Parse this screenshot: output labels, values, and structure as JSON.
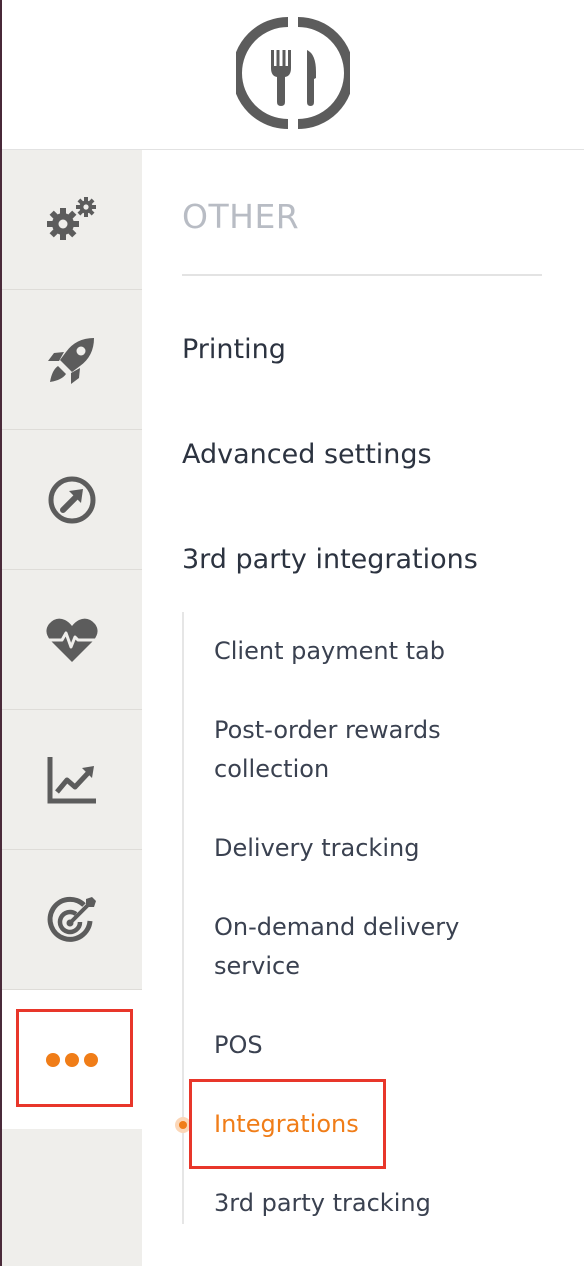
{
  "header": {
    "logo": "fork-knife-logo-icon"
  },
  "rail": {
    "items": [
      {
        "icon": "gears-icon"
      },
      {
        "icon": "rocket-icon"
      },
      {
        "icon": "arrow-circle-icon"
      },
      {
        "icon": "heart-pulse-icon"
      },
      {
        "icon": "line-chart-icon"
      },
      {
        "icon": "target-icon"
      },
      {
        "icon": "more-dots-icon",
        "active": true
      }
    ]
  },
  "panel": {
    "section_title": "OTHER",
    "items": [
      {
        "label": "Printing"
      },
      {
        "label": "Advanced settings"
      },
      {
        "label": "3rd party integrations"
      }
    ],
    "sub_items": [
      {
        "label": "Client payment tab"
      },
      {
        "label": "Post-order rewards collection"
      },
      {
        "label": "Delivery tracking"
      },
      {
        "label": "On-demand delivery service"
      },
      {
        "label": "POS"
      },
      {
        "label": "Integrations",
        "active": true
      },
      {
        "label": "3rd party tracking"
      }
    ]
  },
  "colors": {
    "accent": "#f07d18",
    "highlight": "#e8362a",
    "icon": "#5c5c5c",
    "rail_bg": "#efeeeb"
  }
}
